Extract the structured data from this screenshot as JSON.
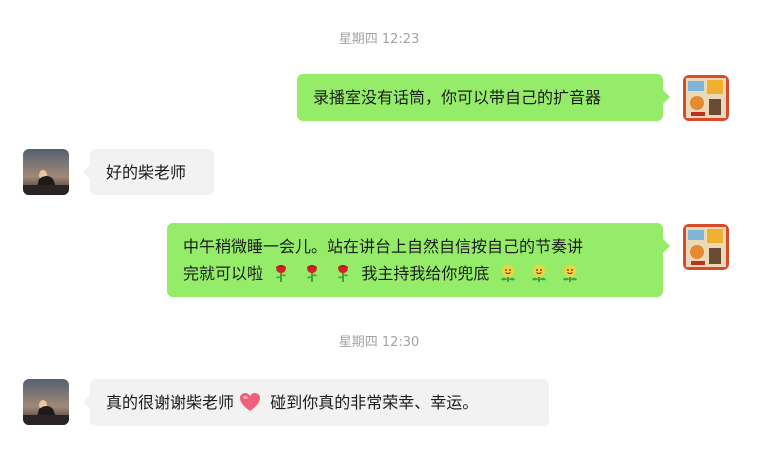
{
  "chat": {
    "timestamp_1": "星期四 12:23",
    "timestamp_2": "星期四 12:30",
    "messages": [
      {
        "side": "out",
        "text": "录播室没有话筒，你可以带自己的扩音器"
      },
      {
        "side": "in",
        "text": "好的柴老师"
      },
      {
        "side": "out",
        "line1": "中午稍微睡一会儿。站在讲台上自然自信按自己的节奏讲",
        "line2_start": "完就可以啦",
        "line2_mid": "我主持我给你兜底",
        "emoji_a": "rose-emoji",
        "emoji_b": "smiling-sprout-emoji"
      },
      {
        "side": "in",
        "text_start": "真的很谢谢柴老师",
        "text_end": "碰到你真的非常荣幸、幸运。",
        "emoji": "heart-emoji"
      }
    ]
  },
  "colors": {
    "outgoing_bubble": "#95ec69",
    "incoming_bubble": "#f2f2f2",
    "timestamp_text": "#a3a3a3",
    "heart": "#f0607a"
  }
}
